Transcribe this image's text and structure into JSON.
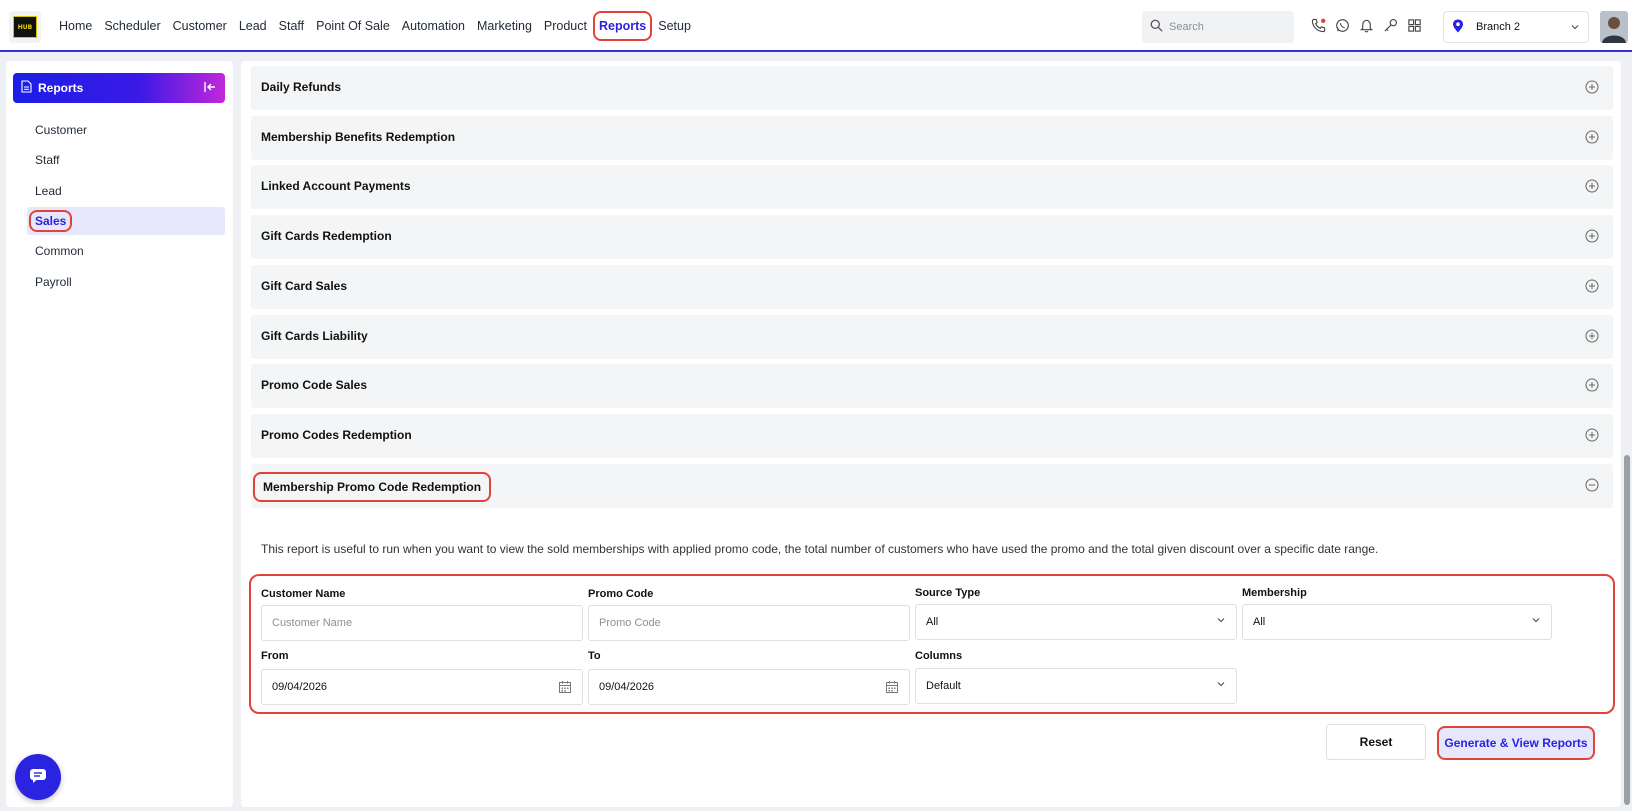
{
  "nav": {
    "items": [
      "Home",
      "Scheduler",
      "Customer",
      "Lead",
      "Staff",
      "Point Of Sale",
      "Automation",
      "Marketing",
      "Product",
      "Reports",
      "Setup"
    ],
    "active": "Reports",
    "logo_text": "HUB"
  },
  "search": {
    "placeholder": "Search"
  },
  "top_icons": [
    "phone-icon",
    "whatsapp-icon",
    "bell-icon",
    "key-icon",
    "grid-icon"
  ],
  "branch": {
    "label": "Branch 2"
  },
  "sidebar": {
    "title": "Reports",
    "items": [
      "Customer",
      "Staff",
      "Lead",
      "Sales",
      "Common",
      "Payroll"
    ],
    "active": "Sales"
  },
  "reports": [
    "Daily Refunds",
    "Membership Benefits Redemption",
    "Linked Account Payments",
    "Gift Cards Redemption",
    "Gift Card Sales",
    "Gift Cards Liability",
    "Promo Code Sales",
    "Promo Codes Redemption",
    "Membership Promo Code Redemption"
  ],
  "open_report": {
    "description": "This report is useful to run when you want to view the sold memberships with applied promo code, the total number of customers who have used the promo and the total given discount over a specific date range.",
    "fields": {
      "customer_name": {
        "label": "Customer Name",
        "placeholder": "Customer Name"
      },
      "promo_code": {
        "label": "Promo Code",
        "placeholder": "Promo Code"
      },
      "source_type": {
        "label": "Source Type",
        "value": "All"
      },
      "membership": {
        "label": "Membership",
        "value": "All"
      },
      "from": {
        "label": "From",
        "value": "09/04/2026"
      },
      "to": {
        "label": "To",
        "value": "09/04/2026"
      },
      "columns": {
        "label": "Columns",
        "value": "Default"
      }
    },
    "reset_label": "Reset",
    "generate_label": "Generate & View Reports"
  },
  "colors": {
    "accent": "#2a24e0",
    "highlight": "#e0433a",
    "active_bg": "#e6e7fb"
  }
}
